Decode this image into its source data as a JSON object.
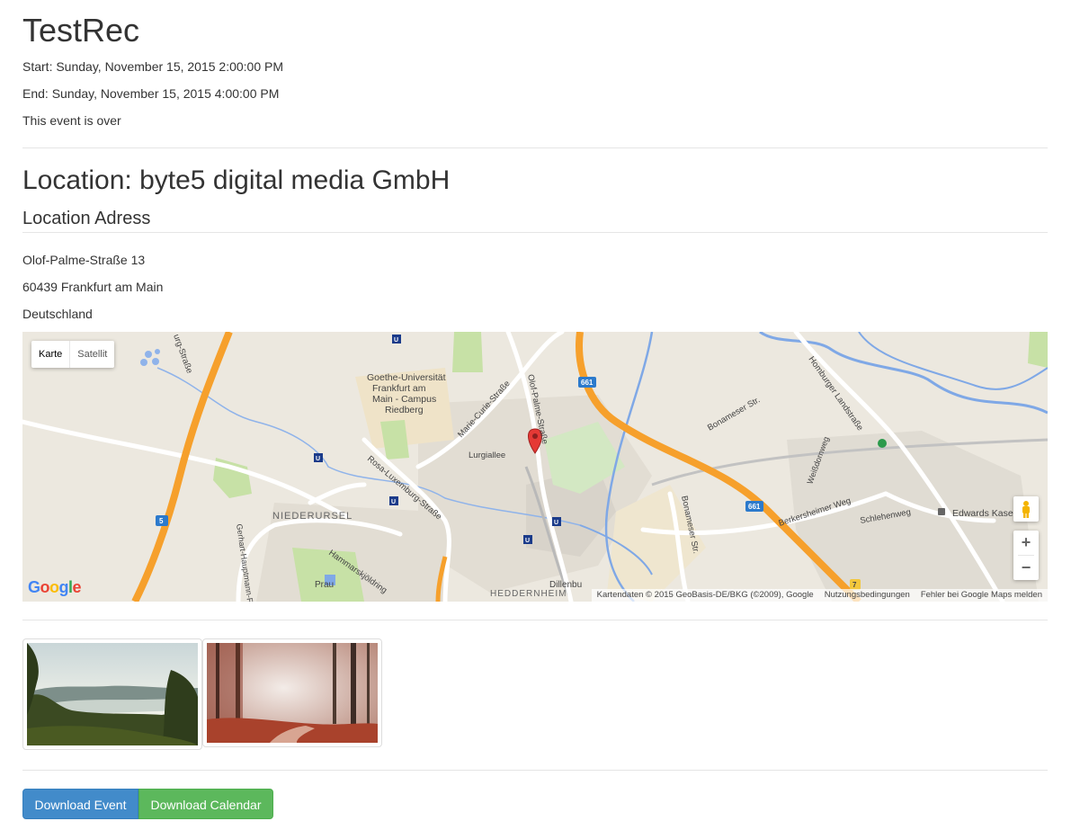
{
  "event": {
    "title": "TestRec",
    "start": "Start: Sunday, November 15, 2015 2:00:00 PM",
    "end": "End: Sunday, November 15, 2015 4:00:00 PM",
    "status": "This event is over"
  },
  "location": {
    "heading": "Location: byte5 digital media GmbH",
    "address_heading": "Location Adress",
    "street": "Olof-Palme-Straße 13",
    "city": "60439 Frankfurt am Main",
    "country": "Deutschland"
  },
  "map": {
    "type_buttons": [
      "Karte",
      "Satellit"
    ],
    "labels": {
      "university_1": "Goethe-Universität",
      "university_2": "Frankfurt am",
      "university_3": "Main - Campus",
      "university_4": "Riedberg",
      "niederursel": "NIEDERURSEL",
      "heddernheim": "HEDDERNHEIM",
      "marie_curie": "Marie-Curie-Straße",
      "olof_palme": "Olof-Palme-Straße",
      "lurgiallee": "Lurgiallee",
      "rosa_luxemburg": "Rosa-Luxemburg-Straße",
      "hammarskjoeld": "Hammarskjöldring",
      "gerhart": "Gerhart-Hauptmann-Ring",
      "homburger": "Homburger Landstraße",
      "bonameser_1": "Bonameser Str.",
      "bonameser_2": "Bonameser Str.",
      "berkersheimer": "Berkersheimer Weg",
      "schlehenweg": "Schlehenweg",
      "weissdornweg": "Weißdornweg",
      "edwards": "Edwards Kase",
      "dillenburger": "Dillenbu",
      "strasse_top": "urg-Straße",
      "shield_661a": "661",
      "shield_661b": "661",
      "shield_5": "5",
      "shield_7": "7",
      "prau": "Prau"
    },
    "logo": "Google",
    "attribution": [
      "Kartendaten © 2015 GeoBasis-DE/BKG (©2009), Google",
      "Nutzungsbedingungen",
      "Fehler bei Google Maps melden"
    ],
    "zoom_in": "+",
    "zoom_out": "−",
    "colors": {
      "land": "#ece8df",
      "highway": "#f6a02c",
      "water": "#7fa8e6",
      "park": "#c7e1a6"
    }
  },
  "gallery": {
    "images": [
      "landscape-lake-photo",
      "autumn-forest-photo"
    ]
  },
  "actions": {
    "download_event": "Download Event",
    "download_calendar": "Download Calendar"
  },
  "colors": {
    "primary": "#428bca",
    "success": "#5cb85c",
    "text": "#333333",
    "rule": "#e5e5e5"
  }
}
